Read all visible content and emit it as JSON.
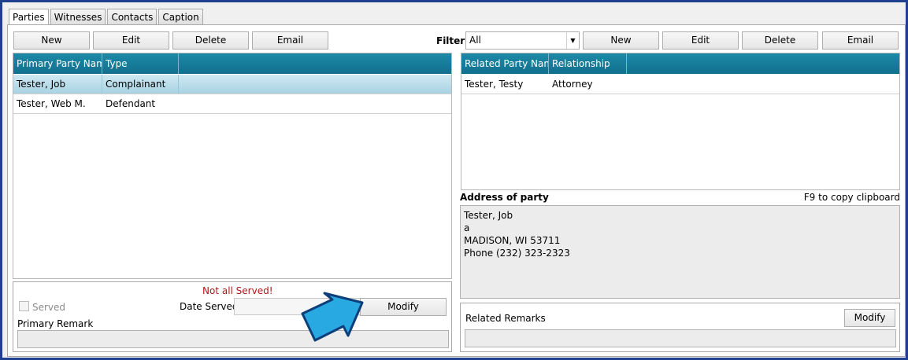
{
  "tabs": [
    "Parties",
    "Witnesses",
    "Contacts",
    "Caption"
  ],
  "left_toolbar": {
    "new": "New",
    "edit": "Edit",
    "delete": "Delete",
    "email": "Email"
  },
  "filter": {
    "label": "Filter:",
    "value": "All"
  },
  "right_toolbar": {
    "new": "New",
    "edit": "Edit",
    "delete": "Delete",
    "email": "Email"
  },
  "primary_grid": {
    "headers": [
      "Primary Party Name",
      "Type"
    ],
    "rows": [
      [
        "Tester, Job",
        "Complainant"
      ],
      [
        "Tester, Web M.",
        "Defendant"
      ]
    ]
  },
  "related_grid": {
    "headers": [
      "Related Party Name",
      "Relationship"
    ],
    "rows": [
      [
        "Tester, Testy",
        "Attorney"
      ]
    ]
  },
  "address": {
    "title": "Address of party",
    "hint": "F9 to copy clipboard",
    "lines": [
      "Tester, Job",
      "a",
      "MADISON, WI 53711",
      "Phone (232) 323-2323"
    ]
  },
  "service": {
    "status": "Not all Served!",
    "served_label": "Served",
    "date_served_label": "Date Served",
    "modify": "Modify",
    "primary_remark_label": "Primary Remark"
  },
  "related_remarks": {
    "label": "Related Remarks",
    "modify": "Modify"
  },
  "colors": {
    "header": "#1c8aa8",
    "alert": "#b01818",
    "frame": "#1f3f8f",
    "arrow": "#29a9e1"
  }
}
